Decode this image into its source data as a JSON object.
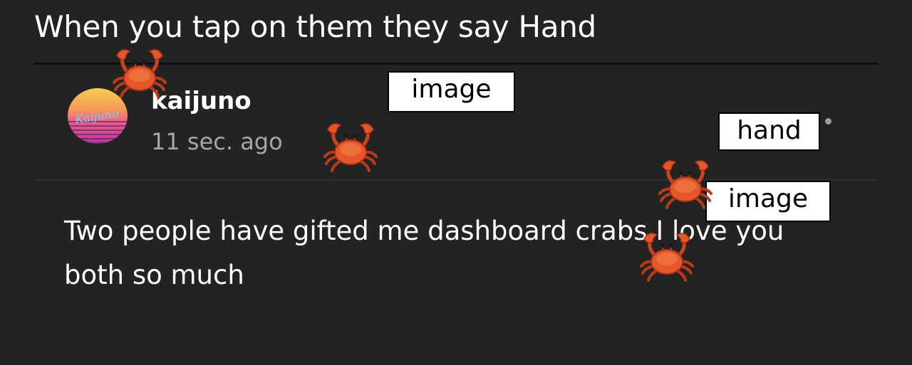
{
  "caption": "When you tap on them they say Hand",
  "post": {
    "username": "kaijuno",
    "timestamp": "11 sec. ago",
    "avatar_text": "Kaijuno",
    "body": "Two people have gifted me dashboard crabs I love you both so much"
  },
  "overlay_labels": {
    "image_1": "image",
    "hand": "hand",
    "image_2": "image"
  },
  "icons": {
    "crab": "crab-emoji",
    "more": "dot-menu"
  },
  "colors": {
    "background": "#232323",
    "text": "#ffffff",
    "muted": "#a7a7a7",
    "crab_shell": "#e5572a"
  }
}
